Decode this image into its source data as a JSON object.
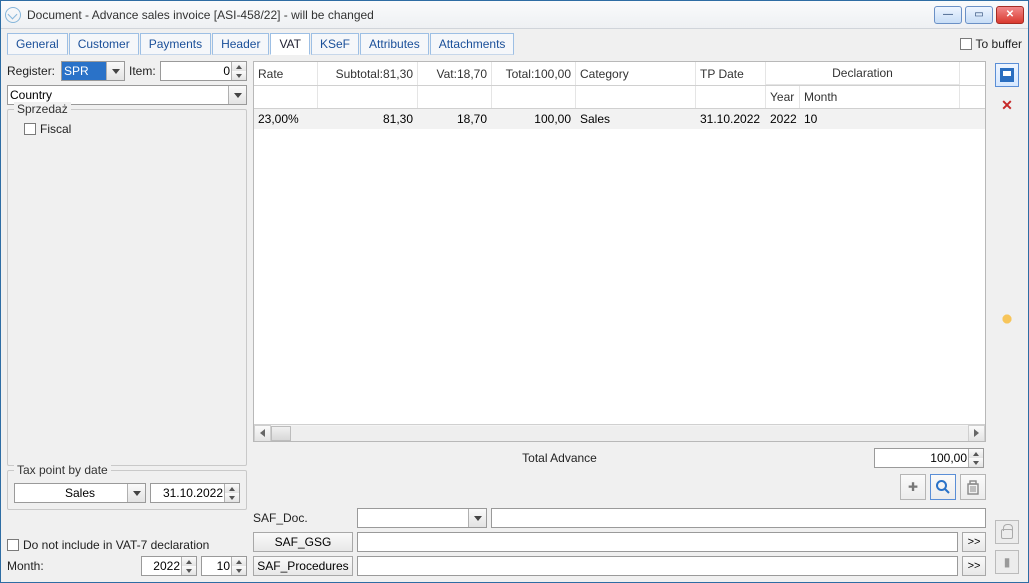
{
  "window": {
    "title": "Document - Advance sales invoice [ASI-458/22]  - will be changed"
  },
  "tabs": {
    "general": "General",
    "customer": "Customer",
    "payments": "Payments",
    "header": "Header",
    "vat": "VAT",
    "ksef": "KSeF",
    "attributes": "Attributes",
    "attachments": "Attachments"
  },
  "buffer": {
    "label": "To buffer"
  },
  "left": {
    "register_lbl": "Register:",
    "register_val": "SPR",
    "item_lbl": "Item:",
    "item_val": "0",
    "country_lbl": "Country",
    "group_sales": "Sprzedaż",
    "fiscal": "Fiscal",
    "taxpoint_lbl": "Tax point by date",
    "taxpoint_type": "Sales",
    "taxpoint_date": "31.10.2022",
    "novat7": "Do not include in VAT-7 declaration",
    "month_lbl": "Month:",
    "year_val": "2022",
    "month_val": "10"
  },
  "grid": {
    "h_rate": "Rate",
    "h_subtotal": "Subtotal:81,30",
    "h_vat": "Vat:18,70",
    "h_total": "Total:100,00",
    "h_category": "Category",
    "h_tpdate": "TP Date",
    "h_declaration": "Declaration",
    "h_year": "Year",
    "h_month": "Month",
    "r1_rate": "23,00%",
    "r1_subtotal": "81,30",
    "r1_vat": "18,70",
    "r1_total": "100,00",
    "r1_category": "Sales",
    "r1_tpdate": "31.10.2022",
    "r1_year": "2022",
    "r1_month": "10"
  },
  "totals": {
    "label": "Total Advance",
    "value": "100,00"
  },
  "saf": {
    "doc_lbl": "SAF_Doc.",
    "gsg_btn": "SAF_GSG",
    "proc_btn": "SAF_Procedures",
    "go": ">>"
  }
}
